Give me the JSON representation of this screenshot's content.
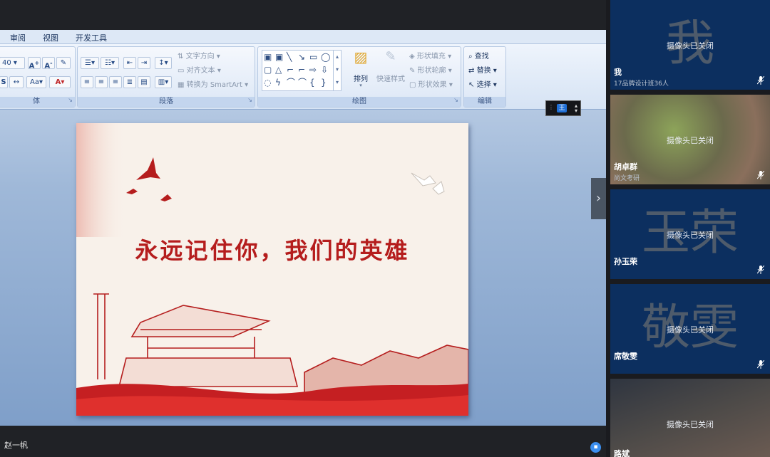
{
  "menu": {
    "items": [
      "审阅",
      "视图",
      "开发工具"
    ]
  },
  "ribbon": {
    "font": {
      "size_value": "40",
      "group_label": "体"
    },
    "paragraph": {
      "text_direction": "文字方向",
      "align_text": "对齐文本",
      "convert_smartart": "转换为 SmartArt",
      "group_label": "段落"
    },
    "drawing": {
      "arrange": "排列",
      "quick_styles": "快速样式",
      "shape_fill": "形状填充",
      "shape_outline": "形状轮廓",
      "shape_effects": "形状效果",
      "group_label": "绘图"
    },
    "editing": {
      "find": "查找",
      "replace": "替换",
      "select": "选择",
      "group_label": "编辑"
    }
  },
  "slide": {
    "title": "永远记住你，我们的英雄"
  },
  "mini_control": {
    "label": "王"
  },
  "presenter": {
    "name": "赵一帆"
  },
  "participants": [
    {
      "name": "我",
      "avatar_text": "我",
      "subtitle": "17品牌设计班36人",
      "camera_status": "摄像头已关闭",
      "bg": "#0c2f5f"
    },
    {
      "name": "胡卓群",
      "avatar_text": "",
      "subtitle": "尚文考研",
      "camera_status": "摄像头已关闭",
      "bg": "#7d6d53"
    },
    {
      "name": "孙玉荣",
      "avatar_text": "玉荣",
      "subtitle": "",
      "camera_status": "摄像头已关闭",
      "bg": "#0c2f5f"
    },
    {
      "name": "席敬雯",
      "avatar_text": "敬雯",
      "subtitle": "",
      "camera_status": "摄像头已关闭",
      "bg": "#0c2f5f"
    },
    {
      "name": "路斌",
      "avatar_text": "",
      "subtitle": "",
      "camera_status": "摄像头已关闭",
      "bg": "#3a3f48"
    }
  ],
  "colors": {
    "accent_red": "#b51d1d",
    "tile_blue": "#0c2f5f",
    "ribbon_blue": "#dce7f6"
  }
}
